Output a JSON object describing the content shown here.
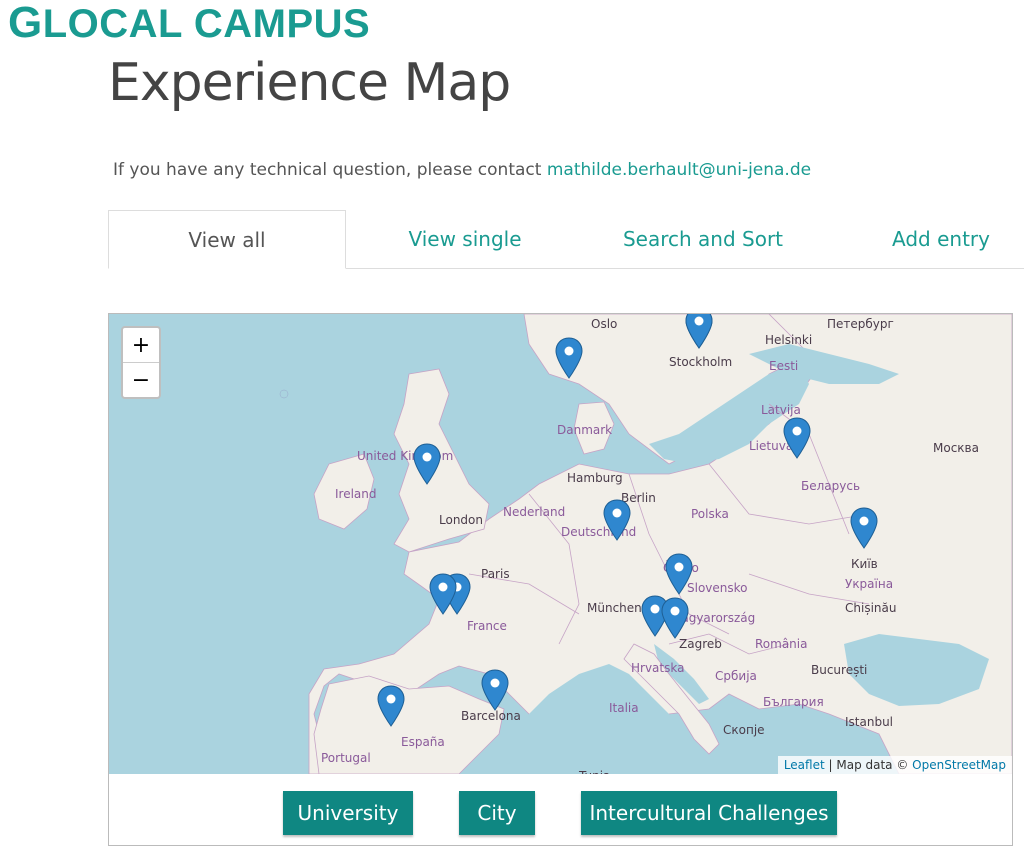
{
  "logo": {
    "first": "G",
    "rest": "LOCAL CAMPUS"
  },
  "page_title": "Experience Map",
  "contact": {
    "text": "If you have any technical question, please contact",
    "email": "mathilde.berhault@uni-jena.de"
  },
  "tabs": [
    {
      "label": "View all",
      "active": true
    },
    {
      "label": "View single",
      "active": false
    },
    {
      "label": "Search and Sort",
      "active": false
    },
    {
      "label": "Add entry",
      "active": false
    }
  ],
  "map": {
    "zoom_in": "+",
    "zoom_out": "−",
    "attribution": {
      "leaflet": "Leaflet",
      "sep": " | Map data © ",
      "osm": "OpenStreetMap"
    },
    "place_labels": [
      "Oslo",
      "Stockholm",
      "Helsinki",
      "Петербург",
      "Eesti",
      "Latvija",
      "Lietuva",
      "Москва",
      "Danmark",
      "United Kingdom",
      "Ireland",
      "London",
      "Hamburg",
      "Berlin",
      "Nederland",
      "Deutschland",
      "Polska",
      "Беларусь",
      "Київ",
      "Україна",
      "Paris",
      "Česko",
      "Slovensko",
      "München",
      "Magyarország",
      "Chișinău",
      "France",
      "Zagreb",
      "România",
      "Hrvatska",
      "Србија",
      "București",
      "България",
      "Italia",
      "Barcelona",
      "España",
      "Скопје",
      "Istanbul",
      "Portugal",
      "Tunis"
    ],
    "marker_count": 14
  },
  "buttons": {
    "university": "University",
    "city": "City",
    "challenges": "Intercultural Challenges"
  }
}
